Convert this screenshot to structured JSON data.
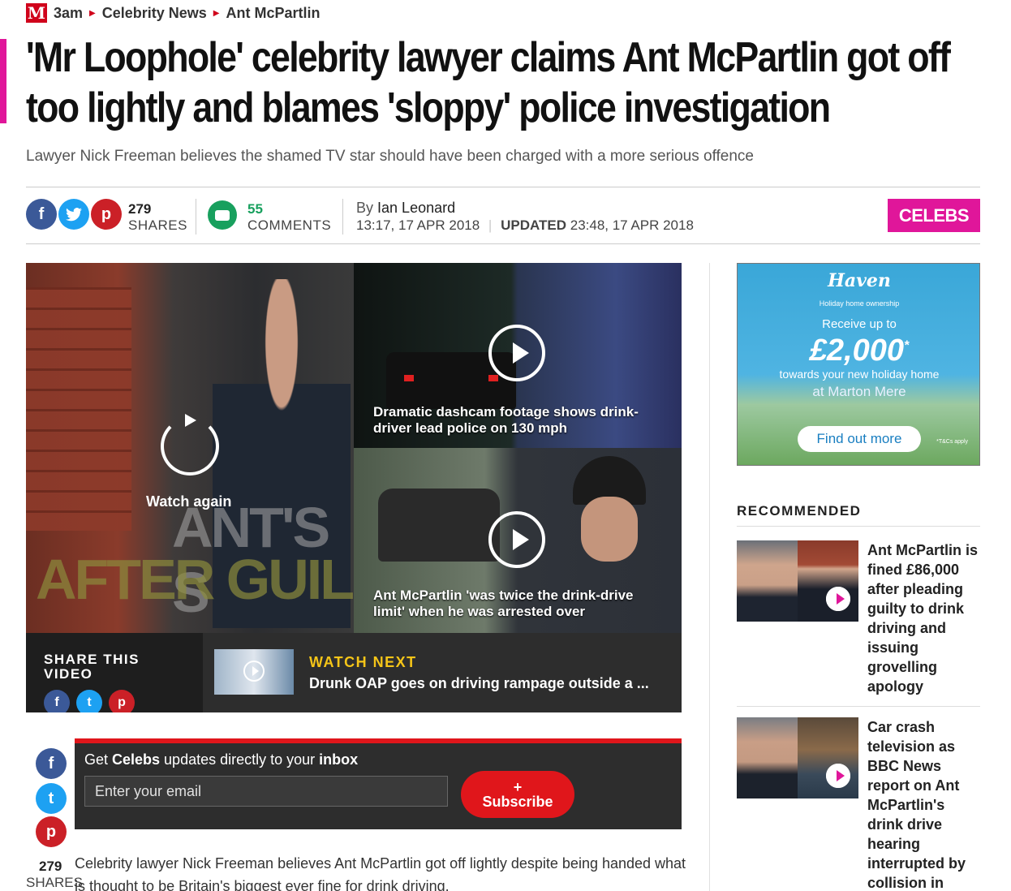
{
  "breadcrumb": {
    "logo": "M",
    "items": [
      "3am",
      "Celebrity News",
      "Ant McPartlin"
    ]
  },
  "article": {
    "headline": "'Mr Loophole' celebrity lawyer claims Ant McPartlin got off too lightly and blames 'sloppy' police investigation",
    "standfirst": "Lawyer Nick Freeman believes the shamed TV star should have been charged with a more serious offence",
    "shares_count": "279",
    "shares_label": "SHARES",
    "comments_count": "55",
    "comments_label": "COMMENTS",
    "by_label": "By",
    "author": "Ian Leonard",
    "published": "13:17, 17 APR 2018",
    "updated_label": "UPDATED",
    "updated": "23:48, 17 APR 2018",
    "section": "CELEBS",
    "body_first": "Celebrity lawyer Nick Freeman believes Ant McPartlin got off lightly despite being handed what is thought to be Britain's biggest ever fine for drink driving."
  },
  "social": {
    "facebook": "f",
    "twitter": "t",
    "pinterest": "p"
  },
  "video": {
    "overlay_line1": "ANT'S S",
    "overlay_line2": "AFTER GUIL",
    "watch_again": "Watch again",
    "tile1_caption": "Dramatic dashcam footage shows drink-driver lead police on 130 mph",
    "tile2_caption": "Ant McPartlin 'was twice the drink-drive limit' when he was arrested over",
    "share_label": "SHARE THIS VIDEO",
    "watch_next_label": "WATCH NEXT",
    "watch_next_title": "Drunk OAP goes on driving rampage outside a ..."
  },
  "newsletter": {
    "prefix": "Get ",
    "topic": "Celebs",
    "middle": " updates directly to your ",
    "target": "inbox",
    "placeholder": "Enter your email",
    "button_plus": "+",
    "button_label": "Subscribe"
  },
  "ad": {
    "brand": "Haven",
    "tagline": "Holiday home ownership",
    "line1": "Receive up to",
    "amount": "£2,000",
    "asterisk": "*",
    "line2": "towards your new holiday home",
    "line3": "at Marton Mere",
    "cta": "Find out more",
    "tc": "*T&Cs apply"
  },
  "recommended": {
    "heading": "RECOMMENDED",
    "items": [
      {
        "title": "Ant McPartlin is fined £86,000 after pleading guilty to drink driving and issuing grovelling apology"
      },
      {
        "title": "Car crash television as BBC News report on Ant McPartlin's drink drive hearing interrupted by collision in"
      }
    ]
  },
  "colors": {
    "brand_red": "#d0021b",
    "celebs_pink": "#e0169a",
    "facebook": "#3b5998",
    "twitter": "#1da1f2",
    "pinterest": "#cb2027",
    "comments_green": "#18a05e",
    "watch_next_yellow": "#f5c518"
  }
}
